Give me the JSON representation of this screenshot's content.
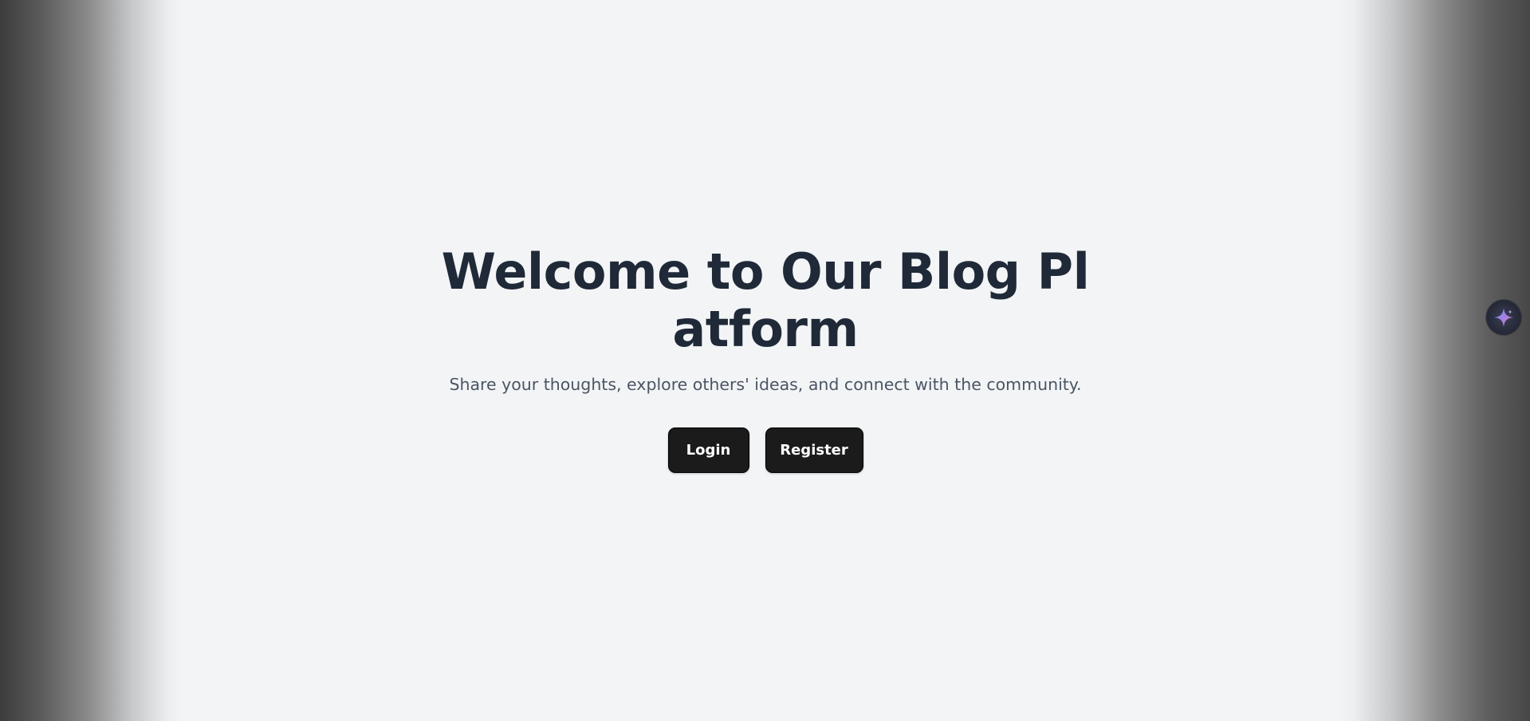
{
  "hero": {
    "title": "Welcome to Our Blog Platform",
    "subtitle": "Share your thoughts, explore others' ideas, and connect with the community."
  },
  "actions": {
    "login_label": "Login",
    "register_label": "Register"
  },
  "assistant": {
    "icon": "sparkle-icon"
  },
  "colors": {
    "page_background": "#f2f4f6",
    "title_text": "#1f2937",
    "subtitle_text": "#4b5563",
    "button_background": "#1b1b1b",
    "button_text": "#ffffff"
  }
}
